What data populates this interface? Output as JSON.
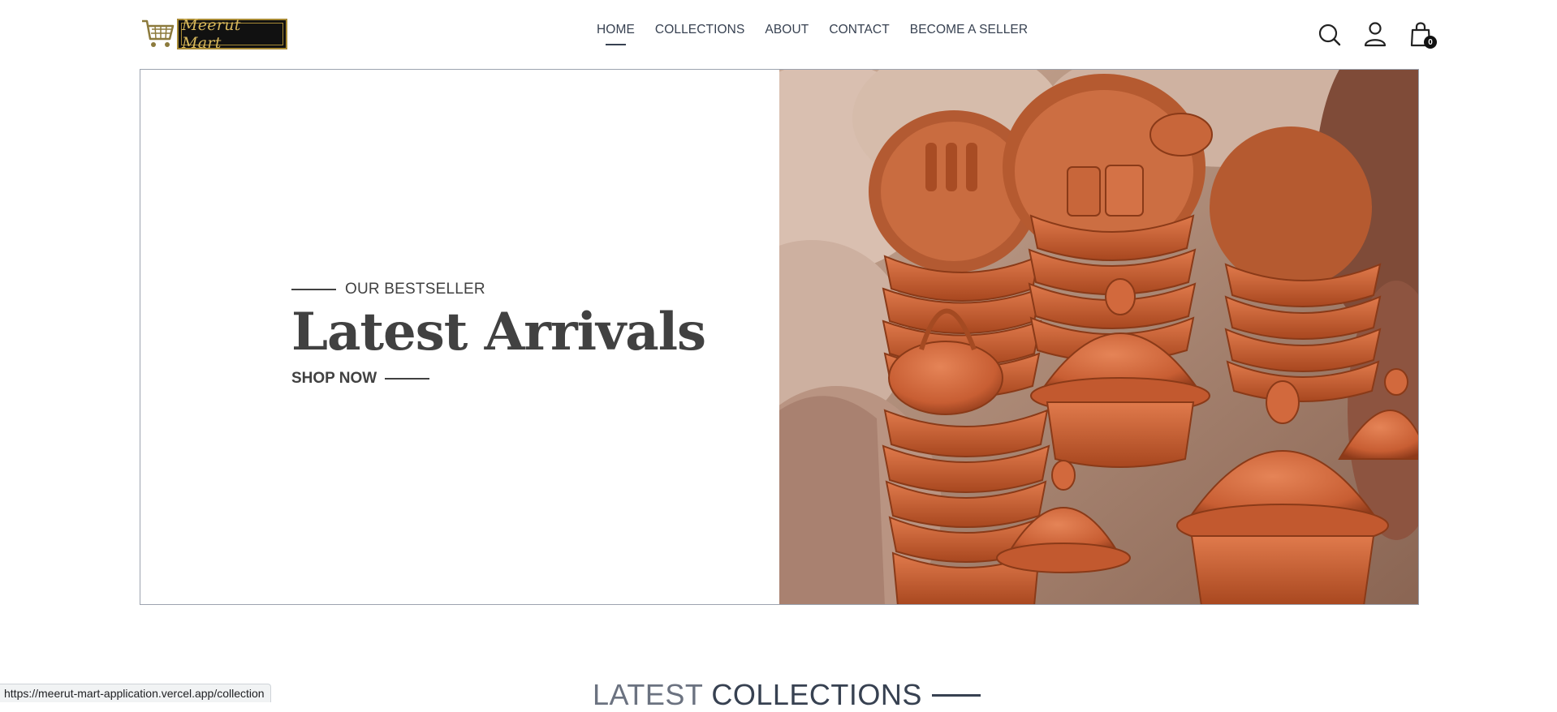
{
  "brand": {
    "logo_text": "Meerut Mart",
    "gold": "#d7b85c",
    "cart_icon": "shopping-cart-icon"
  },
  "nav": {
    "items": [
      {
        "label": "HOME",
        "active": true
      },
      {
        "label": "COLLECTIONS",
        "active": false
      },
      {
        "label": "ABOUT",
        "active": false
      },
      {
        "label": "CONTACT",
        "active": false
      },
      {
        "label": "BECOME A SELLER",
        "active": false
      }
    ]
  },
  "header_icons": {
    "search": "search-icon",
    "profile": "user-icon",
    "cart": "shopping-bag-icon",
    "cart_count": "0"
  },
  "hero": {
    "eyebrow": "OUR BESTSELLER",
    "title": "Latest Arrivals",
    "cta": "SHOP NOW",
    "image_subject": "terracotta pottery and tagines"
  },
  "section": {
    "title_light": "LATEST",
    "title_dark": "COLLECTIONS"
  },
  "status_bar": {
    "url": "https://meerut-mart-application.vercel.app/collection"
  },
  "colors": {
    "text": "#414141",
    "border": "#9ca3af",
    "terracotta": "#c8643a"
  }
}
